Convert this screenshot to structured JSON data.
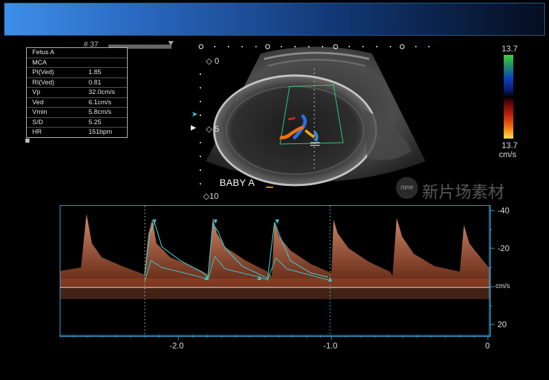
{
  "header": {
    "frame_id": "# 37"
  },
  "measurements": {
    "rows": [
      {
        "label": "Fetus A",
        "value": ""
      },
      {
        "label": "MCA",
        "value": ""
      },
      {
        "label": "PI(Ved)",
        "value": "1.85"
      },
      {
        "label": "RI(Ved)",
        "value": "0.81"
      },
      {
        "label": "Vp",
        "value": "32.0cm/s"
      },
      {
        "label": "Ved",
        "value": "6.1cm/s"
      },
      {
        "label": "Vmin",
        "value": "5.8cm/s"
      },
      {
        "label": "S/D",
        "value": "5.25"
      },
      {
        "label": "HR",
        "value": "151bpm"
      }
    ]
  },
  "image": {
    "depth_labels": [
      "0",
      "5",
      "10"
    ],
    "annotation": "BABY A"
  },
  "colorbar": {
    "max": "13.7",
    "min": "13.7",
    "unit": "cm/s"
  },
  "watermark": {
    "logo": "new",
    "text": "新片场素材"
  },
  "spectrum": {
    "y_ticks": [
      "-40",
      "-20",
      "cm/s",
      "20"
    ],
    "x_ticks": [
      "-2.0",
      "-1.0",
      "0"
    ]
  },
  "colors": {
    "accent": "#3aa0d0",
    "trace": "#3cc8c8",
    "spectrum": "#f0a080"
  }
}
